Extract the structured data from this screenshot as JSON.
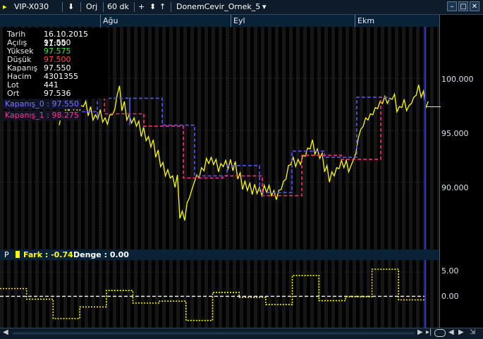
{
  "toolbar": {
    "symbol": "VIP-X030",
    "orj_label": "Orj",
    "period": "60 dk",
    "plus": "+",
    "up": "↑",
    "template": "DonemCevir_Ornek_5"
  },
  "dates": [
    "Ağu",
    "Eyl",
    "Ekm"
  ],
  "info": {
    "rows": [
      {
        "label": "Tarih",
        "value": "16.10.2015 11:00",
        "color": "#ffffff"
      },
      {
        "label": "Açılış",
        "value": "97.550",
        "color": "#ffffff"
      },
      {
        "label": "Yüksek",
        "value": "97.575",
        "color": "#39e639"
      },
      {
        "label": "Düşük",
        "value": "97.500",
        "color": "#ff4a4a"
      },
      {
        "label": "Kapanış",
        "value": "97.550",
        "color": "#ffffff"
      },
      {
        "label": "Hacim",
        "value": "4301355",
        "color": "#ffffff"
      },
      {
        "label": "Lot",
        "value": "441",
        "color": "#ffffff"
      },
      {
        "label": "Ort",
        "value": "97.536",
        "color": "#ffffff"
      }
    ]
  },
  "legend": {
    "kapanis0": "Kapanış_0 : 97.550",
    "kapanis1": "Kapanış_1 : 98.275"
  },
  "colors": {
    "price": "#ffff00",
    "kapanis0": "#5555ff",
    "kapanis1": "#ff2a7a",
    "fark": "#ffff00",
    "denge": "#ffffff"
  },
  "main_axis": {
    "ticks": [
      "100.000",
      "95.000",
      "90.000"
    ]
  },
  "sub_panel": {
    "p_label": "P",
    "fark": "Fark : -0.74",
    "denge": "Denge : 0.00",
    "ticks": [
      "5.00",
      "0.00"
    ]
  },
  "chart_data": [
    {
      "type": "line",
      "ylim": [
        83.5,
        105
      ],
      "yticks": [
        100,
        95,
        90
      ],
      "series": [
        {
          "name": "Kapanış_0",
          "values": [
            97.55
          ]
        },
        {
          "name": "Kapanış_1",
          "values": [
            98.275
          ]
        }
      ],
      "price_path": [
        [
          95.5,
          96.6
        ],
        [
          96.2,
          97.4
        ],
        [
          96.8,
          97.9
        ],
        [
          97.0,
          97.3
        ],
        [
          96.4,
          97.4
        ],
        [
          97.3,
          97.8
        ],
        [
          96.4,
          97.3
        ],
        [
          96.0,
          96.5
        ],
        [
          96.1,
          97.0
        ],
        [
          95.8,
          96.2
        ],
        [
          95.6,
          96.5
        ],
        [
          96.5,
          97.0
        ],
        [
          98.4,
          99.3
        ],
        [
          96.9,
          97.8
        ],
        [
          96.0,
          96.5
        ],
        [
          95.7,
          96.2
        ],
        [
          95.4,
          95.9
        ],
        [
          94.4,
          95.3
        ],
        [
          94.0,
          94.4
        ],
        [
          93.4,
          94.1
        ],
        [
          92.4,
          93.1
        ],
        [
          91.5,
          91.9
        ],
        [
          90.6,
          91.2
        ],
        [
          90.4,
          90.6
        ],
        [
          89.5,
          90.7
        ],
        [
          86.5,
          87.2
        ],
        [
          86.3,
          88.0
        ],
        [
          88.5,
          89.3
        ],
        [
          90.0,
          90.7
        ],
        [
          90.4,
          91.4
        ],
        [
          91.1,
          92.3
        ],
        [
          91.8,
          92.4
        ],
        [
          91.7,
          92.2
        ],
        [
          91.0,
          91.8
        ],
        [
          91.5,
          92.1
        ],
        [
          91.3,
          92.2
        ],
        [
          91.1,
          92.0
        ],
        [
          90.3,
          90.9
        ],
        [
          89.3,
          90.1
        ],
        [
          89.2,
          89.9
        ],
        [
          88.8,
          89.8
        ],
        [
          88.9,
          89.5
        ],
        [
          88.7,
          89.7
        ],
        [
          89.0,
          89.7
        ],
        [
          88.7,
          89.2
        ],
        [
          88.3,
          89.2
        ],
        [
          89.3,
          90.1
        ],
        [
          90.3,
          91.6
        ],
        [
          91.7,
          92.4
        ],
        [
          91.5,
          92.2
        ],
        [
          91.7,
          92.6
        ],
        [
          92.5,
          93.3
        ],
        [
          93.2,
          94.1
        ],
        [
          92.7,
          93.2
        ],
        [
          92.3,
          92.8
        ],
        [
          91.0,
          91.6
        ],
        [
          90.0,
          91.0
        ],
        [
          90.6,
          91.4
        ],
        [
          91.3,
          92.1
        ],
        [
          91.4,
          92.1
        ],
        [
          91.0,
          91.6
        ],
        [
          92.2,
          92.8
        ],
        [
          94.3,
          95.1
        ],
        [
          95.4,
          96.2
        ],
        [
          96.0,
          96.6
        ],
        [
          96.5,
          97.2
        ],
        [
          97.1,
          97.8
        ],
        [
          97.6,
          98.3
        ],
        [
          97.6,
          98.1
        ],
        [
          98.0,
          98.5
        ],
        [
          96.8,
          97.3
        ],
        [
          97.2,
          98.0
        ],
        [
          96.9,
          97.4
        ],
        [
          97.6,
          98.2
        ],
        [
          98.4,
          99.4
        ],
        [
          98.2,
          98.8
        ],
        [
          97.2,
          97.8
        ]
      ],
      "kapanis0_steps": [
        [
          96.8,
          96.0
        ],
        [
          98.1,
          95.5
        ],
        [
          98.1,
          95.5
        ],
        [
          95.5,
          90.6
        ],
        [
          90.6,
          91.6
        ],
        [
          91.6,
          89.0
        ],
        [
          89.0,
          93.0
        ],
        [
          93.0,
          92.4
        ],
        [
          92.4,
          98.2
        ],
        [
          98.2,
          97.55
        ]
      ],
      "kapanis1_steps": [
        [
          98.2,
          96.6
        ],
        [
          96.6,
          95.4
        ],
        [
          95.4,
          90.4
        ],
        [
          90.4,
          90.6
        ],
        [
          90.6,
          88.7
        ],
        [
          88.7,
          92.6
        ],
        [
          92.6,
          92.2
        ],
        [
          92.2,
          98.275
        ]
      ]
    },
    {
      "type": "line",
      "ylim": [
        -6.5,
        7.5
      ],
      "yticks": [
        5,
        0
      ],
      "series": [
        {
          "name": "Fark",
          "values": [
            -0.74
          ]
        },
        {
          "name": "Denge",
          "values": [
            0.0
          ]
        }
      ],
      "fark_steps": [
        1.6,
        -0.6,
        -4.6,
        -2.2,
        1.2,
        -1.4,
        -1.0,
        -5.0,
        0.8,
        -0.2,
        -1.7,
        4.3,
        -0.9,
        -0.1,
        5.6,
        -0.74
      ],
      "denge": 0.0
    }
  ]
}
